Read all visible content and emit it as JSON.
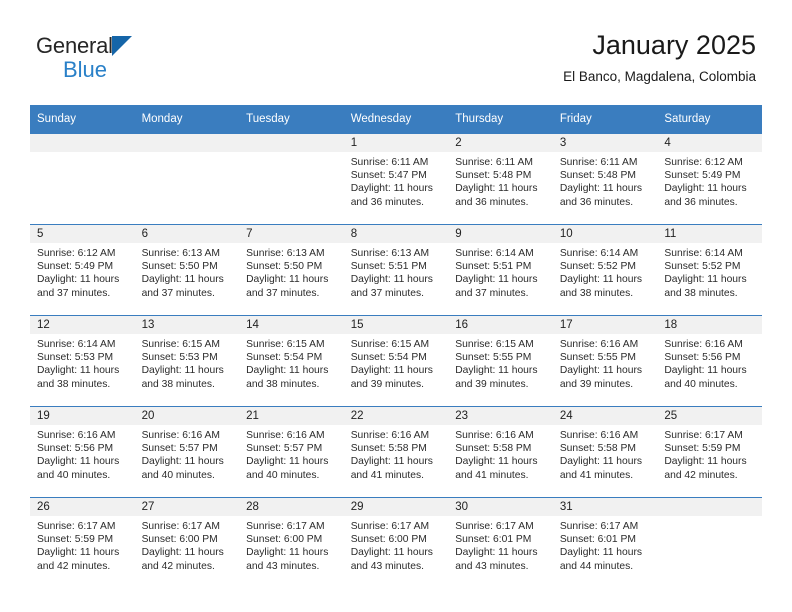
{
  "brand": {
    "name_part1": "General",
    "name_part2": "Blue",
    "triangle_color": "#1565a8",
    "blue_color": "#2980c8"
  },
  "header": {
    "title": "January 2025",
    "subtitle": "El Banco, Magdalena, Colombia"
  },
  "theme": {
    "header_row_bg": "#3a7dbf",
    "header_row_text": "#ffffff",
    "daynum_band_bg": "#f1f1f1",
    "row_separator": "#3a7dbf"
  },
  "calendar": {
    "weekday_headers": [
      "Sunday",
      "Monday",
      "Tuesday",
      "Wednesday",
      "Thursday",
      "Friday",
      "Saturday"
    ],
    "labels": {
      "sunrise_prefix": "Sunrise:",
      "sunset_prefix": "Sunset:",
      "daylight_prefix": "Daylight:"
    },
    "weeks": [
      [
        {
          "day": "",
          "empty": true
        },
        {
          "day": "",
          "empty": true
        },
        {
          "day": "",
          "empty": true
        },
        {
          "day": "1",
          "sunrise": "Sunrise: 6:11 AM",
          "sunset": "Sunset: 5:47 PM",
          "daylight_line1": "Daylight: 11 hours",
          "daylight_line2": "and 36 minutes."
        },
        {
          "day": "2",
          "sunrise": "Sunrise: 6:11 AM",
          "sunset": "Sunset: 5:48 PM",
          "daylight_line1": "Daylight: 11 hours",
          "daylight_line2": "and 36 minutes."
        },
        {
          "day": "3",
          "sunrise": "Sunrise: 6:11 AM",
          "sunset": "Sunset: 5:48 PM",
          "daylight_line1": "Daylight: 11 hours",
          "daylight_line2": "and 36 minutes."
        },
        {
          "day": "4",
          "sunrise": "Sunrise: 6:12 AM",
          "sunset": "Sunset: 5:49 PM",
          "daylight_line1": "Daylight: 11 hours",
          "daylight_line2": "and 36 minutes."
        }
      ],
      [
        {
          "day": "5",
          "sunrise": "Sunrise: 6:12 AM",
          "sunset": "Sunset: 5:49 PM",
          "daylight_line1": "Daylight: 11 hours",
          "daylight_line2": "and 37 minutes."
        },
        {
          "day": "6",
          "sunrise": "Sunrise: 6:13 AM",
          "sunset": "Sunset: 5:50 PM",
          "daylight_line1": "Daylight: 11 hours",
          "daylight_line2": "and 37 minutes."
        },
        {
          "day": "7",
          "sunrise": "Sunrise: 6:13 AM",
          "sunset": "Sunset: 5:50 PM",
          "daylight_line1": "Daylight: 11 hours",
          "daylight_line2": "and 37 minutes."
        },
        {
          "day": "8",
          "sunrise": "Sunrise: 6:13 AM",
          "sunset": "Sunset: 5:51 PM",
          "daylight_line1": "Daylight: 11 hours",
          "daylight_line2": "and 37 minutes."
        },
        {
          "day": "9",
          "sunrise": "Sunrise: 6:14 AM",
          "sunset": "Sunset: 5:51 PM",
          "daylight_line1": "Daylight: 11 hours",
          "daylight_line2": "and 37 minutes."
        },
        {
          "day": "10",
          "sunrise": "Sunrise: 6:14 AM",
          "sunset": "Sunset: 5:52 PM",
          "daylight_line1": "Daylight: 11 hours",
          "daylight_line2": "and 38 minutes."
        },
        {
          "day": "11",
          "sunrise": "Sunrise: 6:14 AM",
          "sunset": "Sunset: 5:52 PM",
          "daylight_line1": "Daylight: 11 hours",
          "daylight_line2": "and 38 minutes."
        }
      ],
      [
        {
          "day": "12",
          "sunrise": "Sunrise: 6:14 AM",
          "sunset": "Sunset: 5:53 PM",
          "daylight_line1": "Daylight: 11 hours",
          "daylight_line2": "and 38 minutes."
        },
        {
          "day": "13",
          "sunrise": "Sunrise: 6:15 AM",
          "sunset": "Sunset: 5:53 PM",
          "daylight_line1": "Daylight: 11 hours",
          "daylight_line2": "and 38 minutes."
        },
        {
          "day": "14",
          "sunrise": "Sunrise: 6:15 AM",
          "sunset": "Sunset: 5:54 PM",
          "daylight_line1": "Daylight: 11 hours",
          "daylight_line2": "and 38 minutes."
        },
        {
          "day": "15",
          "sunrise": "Sunrise: 6:15 AM",
          "sunset": "Sunset: 5:54 PM",
          "daylight_line1": "Daylight: 11 hours",
          "daylight_line2": "and 39 minutes."
        },
        {
          "day": "16",
          "sunrise": "Sunrise: 6:15 AM",
          "sunset": "Sunset: 5:55 PM",
          "daylight_line1": "Daylight: 11 hours",
          "daylight_line2": "and 39 minutes."
        },
        {
          "day": "17",
          "sunrise": "Sunrise: 6:16 AM",
          "sunset": "Sunset: 5:55 PM",
          "daylight_line1": "Daylight: 11 hours",
          "daylight_line2": "and 39 minutes."
        },
        {
          "day": "18",
          "sunrise": "Sunrise: 6:16 AM",
          "sunset": "Sunset: 5:56 PM",
          "daylight_line1": "Daylight: 11 hours",
          "daylight_line2": "and 40 minutes."
        }
      ],
      [
        {
          "day": "19",
          "sunrise": "Sunrise: 6:16 AM",
          "sunset": "Sunset: 5:56 PM",
          "daylight_line1": "Daylight: 11 hours",
          "daylight_line2": "and 40 minutes."
        },
        {
          "day": "20",
          "sunrise": "Sunrise: 6:16 AM",
          "sunset": "Sunset: 5:57 PM",
          "daylight_line1": "Daylight: 11 hours",
          "daylight_line2": "and 40 minutes."
        },
        {
          "day": "21",
          "sunrise": "Sunrise: 6:16 AM",
          "sunset": "Sunset: 5:57 PM",
          "daylight_line1": "Daylight: 11 hours",
          "daylight_line2": "and 40 minutes."
        },
        {
          "day": "22",
          "sunrise": "Sunrise: 6:16 AM",
          "sunset": "Sunset: 5:58 PM",
          "daylight_line1": "Daylight: 11 hours",
          "daylight_line2": "and 41 minutes."
        },
        {
          "day": "23",
          "sunrise": "Sunrise: 6:16 AM",
          "sunset": "Sunset: 5:58 PM",
          "daylight_line1": "Daylight: 11 hours",
          "daylight_line2": "and 41 minutes."
        },
        {
          "day": "24",
          "sunrise": "Sunrise: 6:16 AM",
          "sunset": "Sunset: 5:58 PM",
          "daylight_line1": "Daylight: 11 hours",
          "daylight_line2": "and 41 minutes."
        },
        {
          "day": "25",
          "sunrise": "Sunrise: 6:17 AM",
          "sunset": "Sunset: 5:59 PM",
          "daylight_line1": "Daylight: 11 hours",
          "daylight_line2": "and 42 minutes."
        }
      ],
      [
        {
          "day": "26",
          "sunrise": "Sunrise: 6:17 AM",
          "sunset": "Sunset: 5:59 PM",
          "daylight_line1": "Daylight: 11 hours",
          "daylight_line2": "and 42 minutes."
        },
        {
          "day": "27",
          "sunrise": "Sunrise: 6:17 AM",
          "sunset": "Sunset: 6:00 PM",
          "daylight_line1": "Daylight: 11 hours",
          "daylight_line2": "and 42 minutes."
        },
        {
          "day": "28",
          "sunrise": "Sunrise: 6:17 AM",
          "sunset": "Sunset: 6:00 PM",
          "daylight_line1": "Daylight: 11 hours",
          "daylight_line2": "and 43 minutes."
        },
        {
          "day": "29",
          "sunrise": "Sunrise: 6:17 AM",
          "sunset": "Sunset: 6:00 PM",
          "daylight_line1": "Daylight: 11 hours",
          "daylight_line2": "and 43 minutes."
        },
        {
          "day": "30",
          "sunrise": "Sunrise: 6:17 AM",
          "sunset": "Sunset: 6:01 PM",
          "daylight_line1": "Daylight: 11 hours",
          "daylight_line2": "and 43 minutes."
        },
        {
          "day": "31",
          "sunrise": "Sunrise: 6:17 AM",
          "sunset": "Sunset: 6:01 PM",
          "daylight_line1": "Daylight: 11 hours",
          "daylight_line2": "and 44 minutes."
        },
        {
          "day": "",
          "empty": true
        }
      ]
    ]
  }
}
